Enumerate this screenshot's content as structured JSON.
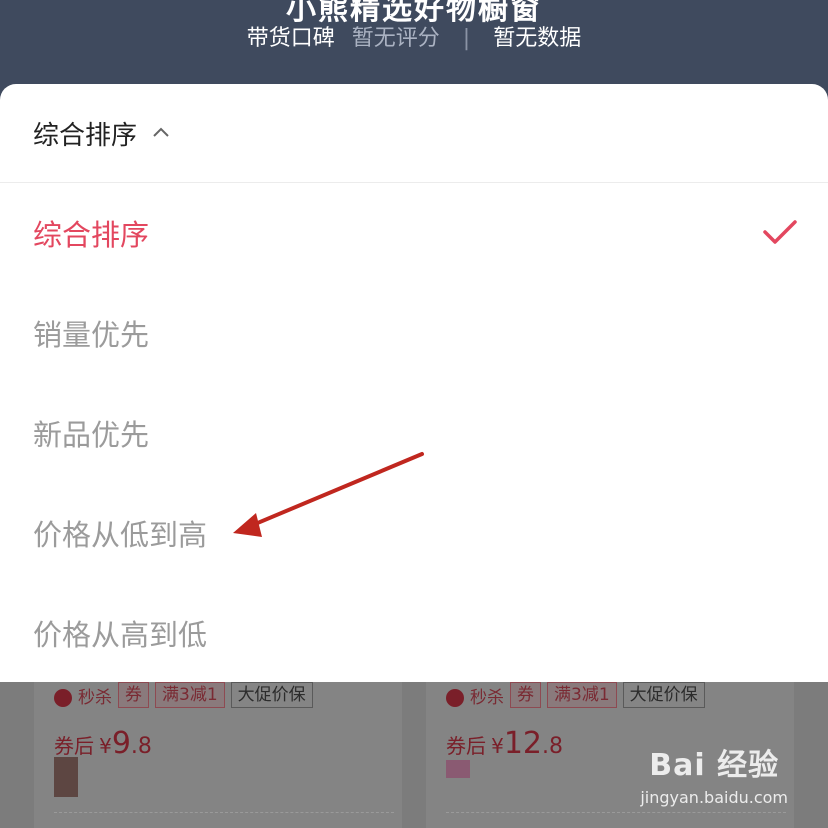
{
  "header": {
    "partial_title": "小熊精选好物橱窗",
    "stats_label": "带货口碑",
    "stats_score": "暂无评分",
    "stats_data": "暂无数据"
  },
  "sort_sheet": {
    "current_label": "综合排序",
    "options": [
      {
        "label": "综合排序",
        "selected": true
      },
      {
        "label": "销量优先",
        "selected": false
      },
      {
        "label": "新品优先",
        "selected": false
      },
      {
        "label": "价格从低到高",
        "selected": false
      },
      {
        "label": "价格从高到低",
        "selected": false
      }
    ],
    "accent_color": "#e3475f"
  },
  "products": [
    {
      "flash": "秒杀",
      "coupon": "券",
      "deal": "满3减1",
      "guarantee": "大促价保",
      "price_prefix": "券后",
      "currency": "¥",
      "price_int": "9",
      "price_dec": ".8"
    },
    {
      "flash": "秒杀",
      "coupon": "券",
      "deal": "满3减1",
      "guarantee": "大促价保",
      "price_prefix": "券后",
      "currency": "¥",
      "price_int": "12",
      "price_dec": ".8"
    }
  ],
  "watermark": {
    "brand": "Bai 经验",
    "url": "jingyan.baidu.com"
  }
}
